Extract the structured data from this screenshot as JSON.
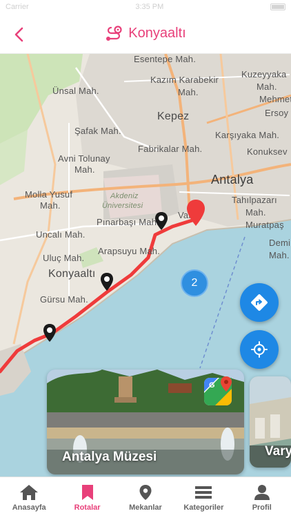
{
  "status_bar": {
    "left": "Carrier",
    "time": "3:35 PM"
  },
  "header": {
    "title": "Konyaaltı",
    "accent_color": "#e8407a"
  },
  "map": {
    "labels": {
      "esentepe": "Esentepe Mah.",
      "kazim": "Kazım Karabekir",
      "kazim2": "Mah.",
      "kuzeyyaka": "Kuzeyyaka",
      "kuzeyyaka2": "Mah.",
      "unsal": "Ünsal Mah.",
      "mehmet": "Mehmet",
      "ersoy": "Ersoy",
      "kepez": "Kepez",
      "safak": "Şafak Mah.",
      "karsiyaka": "Karşıyaka Mah.",
      "fabrikalar": "Fabrikalar Mah.",
      "konuksever": "Konuksev",
      "avni": "Avni Tolunay",
      "avni2": "Mah.",
      "akdeniz": "Akdeniz",
      "universitesi": "Üniversitesi",
      "antalya": "Antalya",
      "molla": "Molla Yusuf",
      "molla2": "Mah.",
      "tahilpazari": "Tahılpazarı",
      "tahilpazari2": "Mah.",
      "pinarbasi": "Pınarbaşı Mah.",
      "varlik": "Varlık",
      "muratpasa": "Muratpaş",
      "uncali": "Uncalı Mah.",
      "arapsuyu": "Arapsuyu Mah.",
      "demi": "Demi",
      "demi2": "Mah.",
      "uluc": "Uluç Mah.",
      "konyaalti": "Konyaaltı",
      "gursu": "Gürsu Mah."
    },
    "cluster_count": "2"
  },
  "cards": [
    {
      "title": "Antalya Müzesi"
    },
    {
      "title": "Vary"
    }
  ],
  "tabs": [
    {
      "label": "Anasayfa",
      "icon": "home-icon"
    },
    {
      "label": "Rotalar",
      "icon": "bookmark-icon",
      "active": true
    },
    {
      "label": "Mekanlar",
      "icon": "location-pin-icon"
    },
    {
      "label": "Kategoriler",
      "icon": "menu-icon"
    },
    {
      "label": "Profil",
      "icon": "person-icon"
    }
  ]
}
